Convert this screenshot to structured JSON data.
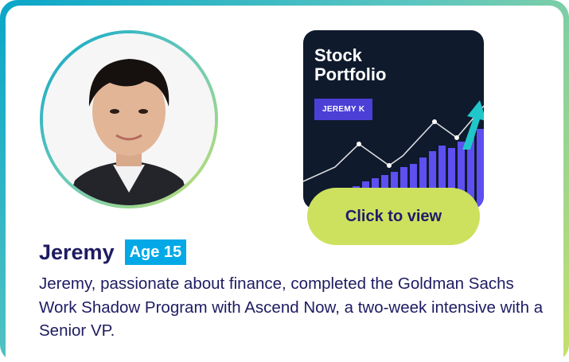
{
  "profile": {
    "name": "Jeremy",
    "age_label": "Age 15",
    "bio": "Jeremy, passionate about finance, completed the Goldman Sachs Work Shadow Program with Ascend Now, a two-week intensive with a Senior VP."
  },
  "portfolio": {
    "title_line1": "Stock",
    "title_line2": "Portfolio",
    "author_tag": "JEREMY K",
    "button_label": "Click to view"
  },
  "colors": {
    "accent_lime": "#cde15e",
    "accent_cyan": "#03a9e6",
    "text_navy": "#1e1b62",
    "thumb_bg": "#0f1a2d",
    "tag_purple": "#4b3fd6"
  }
}
